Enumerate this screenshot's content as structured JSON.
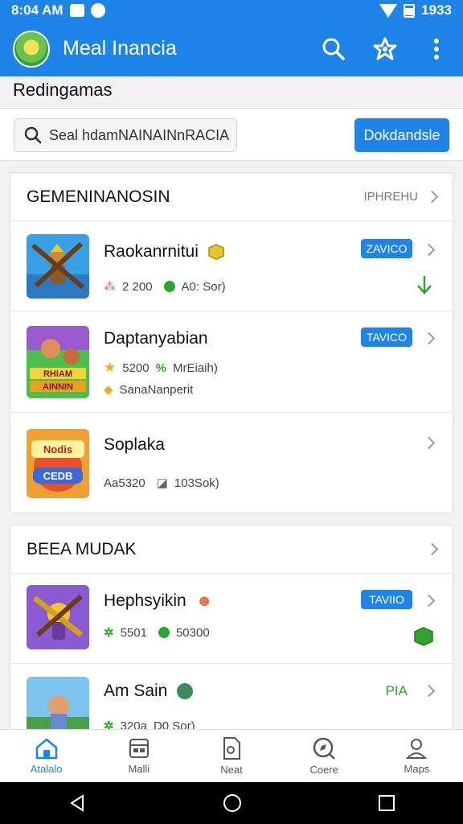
{
  "status_bar": {
    "time": "8:04 AM",
    "right_text": "1933"
  },
  "app": {
    "title": "Meal Inancia"
  },
  "subheader": {
    "title": "Redingamas"
  },
  "search": {
    "value": "Seal hdamNAINAINnRACIA",
    "button_label": "Dokdandsle"
  },
  "sections": [
    {
      "title": "GEMENINANOSIN",
      "more_label": "IPHREHU",
      "items": [
        {
          "name": "Raokanrnitui",
          "meta1": "2 200",
          "meta2": "A0: Sor)",
          "badge": "ZAVICO"
        },
        {
          "name": "Daptanyabian",
          "meta1": "5200",
          "meta2": "MrEiaih)",
          "meta3": "SanaNanperit",
          "badge": "TAVICO"
        },
        {
          "name": "Soplaka",
          "meta1": "Aa5320",
          "meta2": "103Sok)"
        }
      ]
    },
    {
      "title": "BEEA MUDAK",
      "items": [
        {
          "name": "Hephsyikin",
          "meta1": "5501",
          "meta2": "50300",
          "badge": "TAVIIO"
        },
        {
          "name": "Am Sain",
          "meta1": "320a",
          "meta2": "D0 Sor)",
          "side_label": "PIA"
        }
      ]
    }
  ],
  "bottom_nav": [
    {
      "label": "Atalalo",
      "icon": "home-icon"
    },
    {
      "label": "Malli",
      "icon": "grid-icon"
    },
    {
      "label": "Neat",
      "icon": "document-icon"
    },
    {
      "label": "Coere",
      "icon": "compass-icon"
    },
    {
      "label": "Maps",
      "icon": "person-icon"
    }
  ],
  "colors": {
    "primary": "#1e84e8",
    "green": "#2fa32f",
    "star": "#f5a623"
  }
}
